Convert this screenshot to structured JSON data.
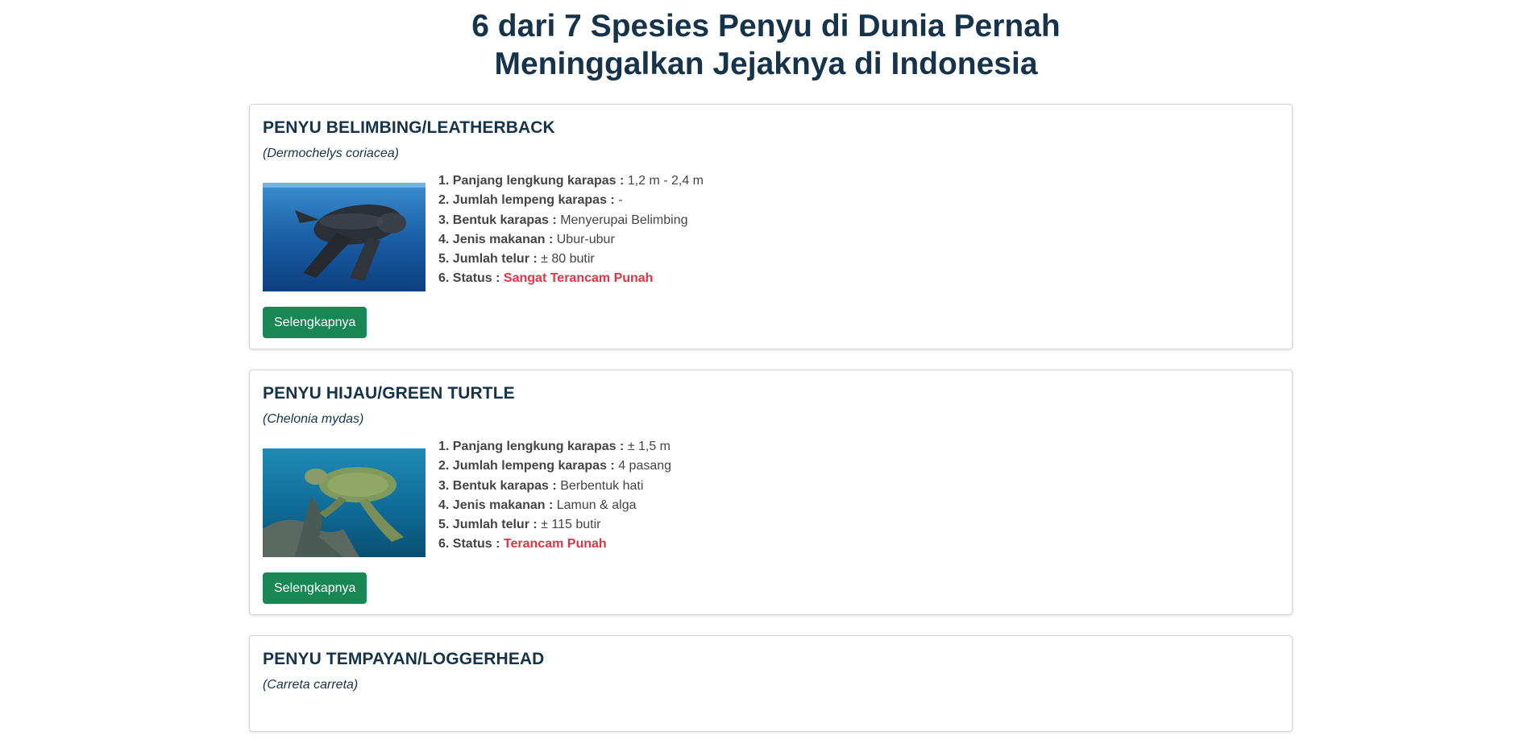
{
  "page": {
    "title": "6 dari 7 Spesies Penyu di Dunia Pernah Meninggalkan Jejaknya di Indonesia"
  },
  "species": [
    {
      "name": "PENYU BELIMBING/LEATHERBACK",
      "scientific": "(Dermochelys coriacea)",
      "image_icon": "leatherback-turtle-photo",
      "facts": [
        {
          "label": "1. Panjang lengkung karapas :",
          "value": "1,2 m - 2,4 m"
        },
        {
          "label": "2. Jumlah lempeng karapas :",
          "value": "-"
        },
        {
          "label": "3. Bentuk karapas :",
          "value": "Menyerupai Belimbing"
        },
        {
          "label": "4. Jenis makanan :",
          "value": "Ubur-ubur"
        },
        {
          "label": "5. Jumlah telur :",
          "value": "± 80 butir"
        },
        {
          "label": "6. Status :",
          "value": "Sangat Terancam Punah"
        }
      ],
      "button_label": "Selengkapnya"
    },
    {
      "name": "PENYU HIJAU/GREEN TURTLE",
      "scientific": "(Chelonia mydas)",
      "image_icon": "green-turtle-photo",
      "facts": [
        {
          "label": "1. Panjang lengkung karapas :",
          "value": "± 1,5 m"
        },
        {
          "label": "2. Jumlah lempeng karapas :",
          "value": "4 pasang"
        },
        {
          "label": "3. Bentuk karapas :",
          "value": "Berbentuk hati"
        },
        {
          "label": "4. Jenis makanan :",
          "value": "Lamun & alga"
        },
        {
          "label": "5. Jumlah telur :",
          "value": "± 115 butir"
        },
        {
          "label": "6. Status :",
          "value": "Terancam Punah"
        }
      ],
      "button_label": "Selengkapnya"
    },
    {
      "name": "PENYU TEMPAYAN/LOGGERHEAD",
      "scientific": "(Carreta carreta)"
    }
  ],
  "colors": {
    "heading": "#17334a",
    "status": "#dc3545",
    "button": "#198754"
  }
}
